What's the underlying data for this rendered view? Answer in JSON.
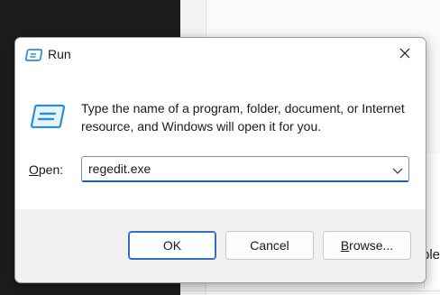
{
  "dialog": {
    "title": "Run",
    "description": "Type the name of a program, folder, document, or Internet resource, and Windows will open it for you.",
    "open_label_accel": "O",
    "open_label_rest": "pen:",
    "input_value": "regedit.exe",
    "buttons": {
      "ok": "OK",
      "cancel": "Cancel",
      "browse_accel": "B",
      "browse_rest": "rowse..."
    }
  },
  "background": {
    "peek_text": "ple,"
  },
  "colors": {
    "accent": "#1a5fb4",
    "icon_blue": "#2b8fd6"
  },
  "icons": {
    "title": "run-app-icon",
    "main": "run-app-icon",
    "close": "close-icon",
    "dropdown": "chevron-down-icon"
  }
}
